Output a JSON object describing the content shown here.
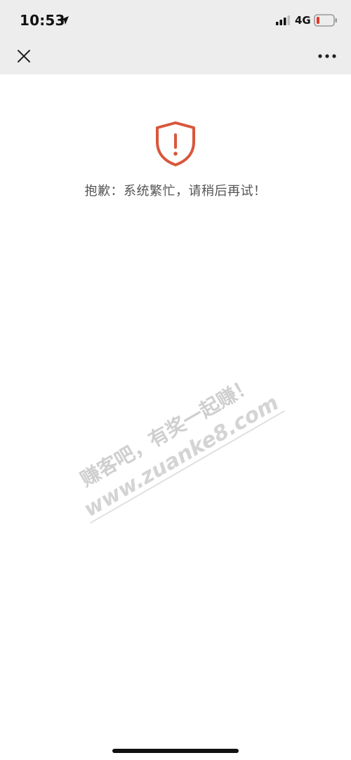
{
  "status_bar": {
    "time": "10:53",
    "network": "4G"
  },
  "nav": {
    "close_icon": "close-icon",
    "more_icon": "more-icon"
  },
  "error": {
    "icon": "shield-exclamation-icon",
    "message": "抱歉：系统繁忙，请稍后再试！"
  },
  "watermark": {
    "line1": "赚客吧，有奖一起赚！",
    "line2": "www.zuanke8.com"
  },
  "colors": {
    "topbar_bg": "#ededed",
    "accent_error": "#d9573b",
    "battery_low": "#e5382d",
    "text_gray": "#555555"
  }
}
